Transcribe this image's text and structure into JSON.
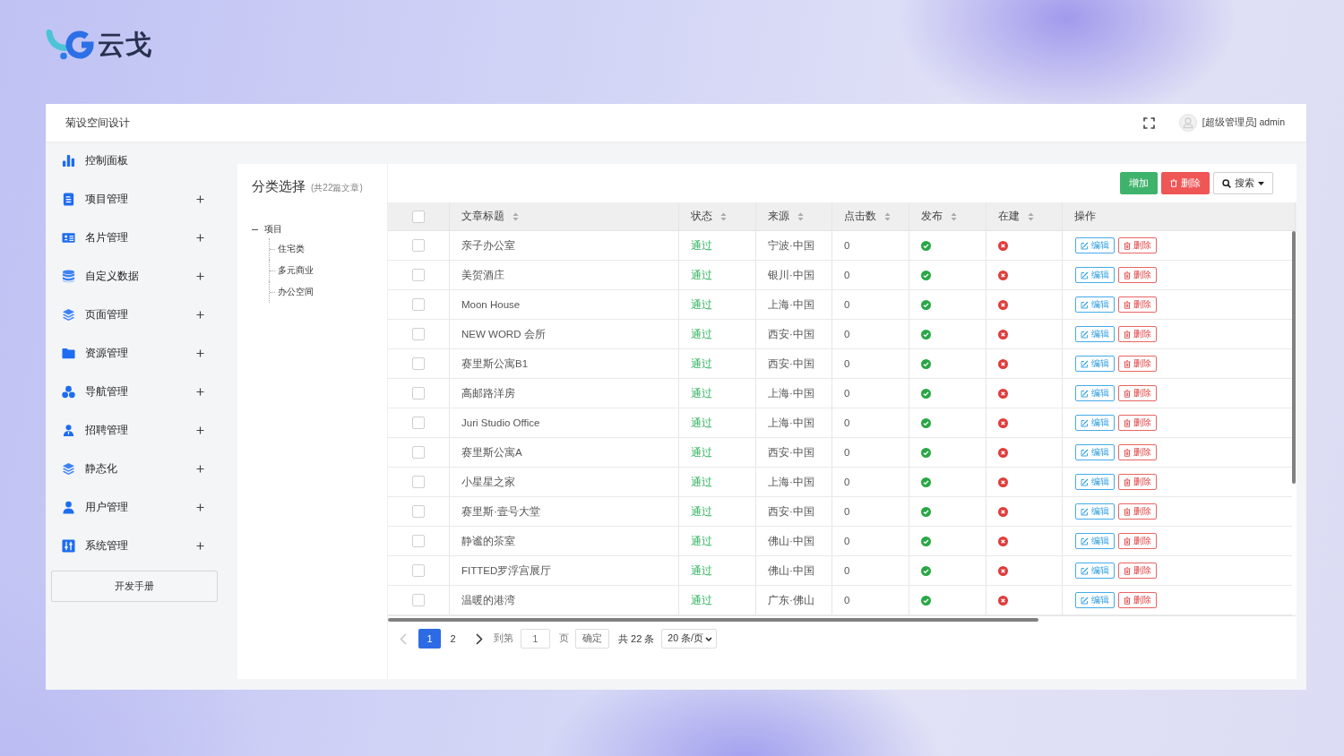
{
  "brand": {
    "name": "云戈"
  },
  "header": {
    "title": "菊设空间设计",
    "user": "[超级管理员] admin"
  },
  "sidebar": {
    "items": [
      {
        "label": "控制面板",
        "expandable": false
      },
      {
        "label": "项目管理",
        "expandable": true
      },
      {
        "label": "名片管理",
        "expandable": true
      },
      {
        "label": "自定义数据",
        "expandable": true
      },
      {
        "label": "页面管理",
        "expandable": true
      },
      {
        "label": "资源管理",
        "expandable": true
      },
      {
        "label": "导航管理",
        "expandable": true
      },
      {
        "label": "招聘管理",
        "expandable": true
      },
      {
        "label": "静态化",
        "expandable": true
      },
      {
        "label": "用户管理",
        "expandable": true
      },
      {
        "label": "系统管理",
        "expandable": true
      }
    ],
    "manual_button": "开发手册"
  },
  "category_panel": {
    "title": "分类选择",
    "count": "(共22篇文章)",
    "tree": [
      {
        "label": "项目",
        "expanded": true,
        "children": [
          {
            "label": "住宅类"
          },
          {
            "label": "多元商业"
          },
          {
            "label": "办公空间"
          }
        ]
      }
    ]
  },
  "toolbar": {
    "buttons": [
      {
        "label": "增加",
        "kind": "add"
      },
      {
        "label": "删除",
        "kind": "delete"
      },
      {
        "label": "搜索",
        "kind": "search"
      }
    ]
  },
  "table": {
    "select_all": {
      "checked": false
    },
    "columns": [
      {
        "label": "文章标题",
        "sortable": true
      },
      {
        "label": "状态",
        "sortable": true
      },
      {
        "label": "来源",
        "sortable": true
      },
      {
        "label": "点击数",
        "sortable": true
      },
      {
        "label": "发布",
        "sortable": true
      },
      {
        "label": "在建",
        "sortable": true
      },
      {
        "label": "操作",
        "sortable": false
      }
    ],
    "rows": [
      {
        "checked": false,
        "title": "亲子办公室",
        "status": "通过",
        "source": "宁波·中国",
        "clicks": "0",
        "published": true,
        "under_construction": false,
        "actions": [
          {
            "label": "编辑",
            "kind": "edit"
          },
          {
            "label": "删除",
            "kind": "delete"
          }
        ]
      },
      {
        "checked": false,
        "title": "美贺酒庄",
        "status": "通过",
        "source": "银川·中国",
        "clicks": "0",
        "published": true,
        "under_construction": false,
        "actions": [
          {
            "label": "编辑",
            "kind": "edit"
          },
          {
            "label": "删除",
            "kind": "delete"
          }
        ]
      },
      {
        "checked": false,
        "title": "Moon House",
        "status": "通过",
        "source": "上海·中国",
        "clicks": "0",
        "published": true,
        "under_construction": false,
        "actions": [
          {
            "label": "编辑",
            "kind": "edit"
          },
          {
            "label": "删除",
            "kind": "delete"
          }
        ]
      },
      {
        "checked": false,
        "title": "NEW WORD 会所",
        "status": "通过",
        "source": "西安·中国",
        "clicks": "0",
        "published": true,
        "under_construction": false,
        "actions": [
          {
            "label": "编辑",
            "kind": "edit"
          },
          {
            "label": "删除",
            "kind": "delete"
          }
        ]
      },
      {
        "checked": false,
        "title": "赛里斯公寓B1",
        "status": "通过",
        "source": "西安·中国",
        "clicks": "0",
        "published": true,
        "under_construction": false,
        "actions": [
          {
            "label": "编辑",
            "kind": "edit"
          },
          {
            "label": "删除",
            "kind": "delete"
          }
        ]
      },
      {
        "checked": false,
        "title": "高邮路洋房",
        "status": "通过",
        "source": "上海·中国",
        "clicks": "0",
        "published": true,
        "under_construction": false,
        "actions": [
          {
            "label": "编辑",
            "kind": "edit"
          },
          {
            "label": "删除",
            "kind": "delete"
          }
        ]
      },
      {
        "checked": false,
        "title": "Juri Studio Office",
        "status": "通过",
        "source": "上海·中国",
        "clicks": "0",
        "published": true,
        "under_construction": false,
        "actions": [
          {
            "label": "编辑",
            "kind": "edit"
          },
          {
            "label": "删除",
            "kind": "delete"
          }
        ]
      },
      {
        "checked": false,
        "title": "赛里斯公寓A",
        "status": "通过",
        "source": "西安·中国",
        "clicks": "0",
        "published": true,
        "under_construction": false,
        "actions": [
          {
            "label": "编辑",
            "kind": "edit"
          },
          {
            "label": "删除",
            "kind": "delete"
          }
        ]
      },
      {
        "checked": false,
        "title": "小星星之家",
        "status": "通过",
        "source": "上海·中国",
        "clicks": "0",
        "published": true,
        "under_construction": false,
        "actions": [
          {
            "label": "编辑",
            "kind": "edit"
          },
          {
            "label": "删除",
            "kind": "delete"
          }
        ]
      },
      {
        "checked": false,
        "title": "赛里斯·壹号大堂",
        "status": "通过",
        "source": "西安·中国",
        "clicks": "0",
        "published": true,
        "under_construction": false,
        "actions": [
          {
            "label": "编辑",
            "kind": "edit"
          },
          {
            "label": "删除",
            "kind": "delete"
          }
        ]
      },
      {
        "checked": false,
        "title": "静谧的茶室",
        "status": "通过",
        "source": "佛山·中国",
        "clicks": "0",
        "published": true,
        "under_construction": false,
        "actions": [
          {
            "label": "编辑",
            "kind": "edit"
          },
          {
            "label": "删除",
            "kind": "delete"
          }
        ]
      },
      {
        "checked": false,
        "title": "FITTED罗浮宫展厅",
        "status": "通过",
        "source": "佛山·中国",
        "clicks": "0",
        "published": true,
        "under_construction": false,
        "actions": [
          {
            "label": "编辑",
            "kind": "edit"
          },
          {
            "label": "删除",
            "kind": "delete"
          }
        ]
      },
      {
        "checked": false,
        "title": "温暖的港湾",
        "status": "通过",
        "source": "广东·佛山",
        "clicks": "0",
        "published": true,
        "under_construction": false,
        "actions": [
          {
            "label": "编辑",
            "kind": "edit"
          },
          {
            "label": "删除",
            "kind": "delete"
          }
        ]
      }
    ]
  },
  "pagination": {
    "prev_disabled": true,
    "pages": [
      {
        "label": "1",
        "selected": true
      },
      {
        "label": "2",
        "selected": false
      }
    ],
    "next_disabled": false,
    "jump_label": "到第",
    "jump_value": "1",
    "jump_suffix": "页",
    "confirm": "确定",
    "total": "共 22 条",
    "page_size": "20 条/页"
  }
}
